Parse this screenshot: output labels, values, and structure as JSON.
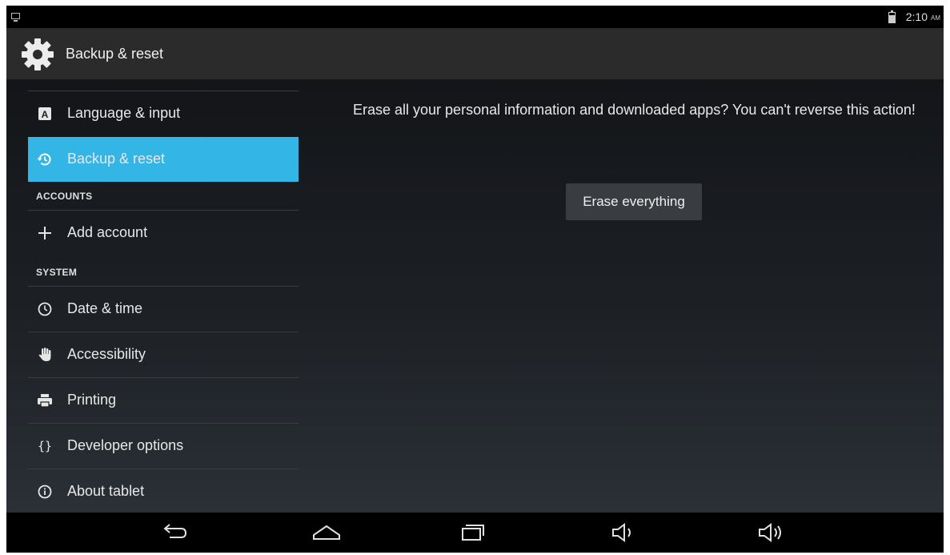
{
  "status_bar": {
    "time": "2:10",
    "ampm": "AM"
  },
  "action_bar": {
    "title": "Backup & reset",
    "icon": "gear-icon"
  },
  "sidebar": {
    "items": [
      {
        "label": "Language & input",
        "icon": "keyboard-a-icon"
      },
      {
        "label": "Backup & reset",
        "icon": "restore-icon",
        "selected": true
      },
      {
        "label": "Add account",
        "icon": "plus-icon"
      },
      {
        "label": "Date & time",
        "icon": "clock-icon"
      },
      {
        "label": "Accessibility",
        "icon": "hand-icon"
      },
      {
        "label": "Printing",
        "icon": "printer-icon"
      },
      {
        "label": "Developer options",
        "icon": "braces-icon"
      },
      {
        "label": "About tablet",
        "icon": "info-icon"
      }
    ],
    "sections": {
      "accounts": "ACCOUNTS",
      "system": "SYSTEM"
    },
    "selected_color": "#33b5e5"
  },
  "main": {
    "message": "Erase all your personal information and downloaded apps? You can't reverse this action!",
    "erase_button_label": "Erase everything"
  },
  "nav_bar": {
    "buttons": [
      "back-icon",
      "home-icon",
      "recents-icon",
      "volume-down-icon",
      "volume-up-icon"
    ]
  }
}
